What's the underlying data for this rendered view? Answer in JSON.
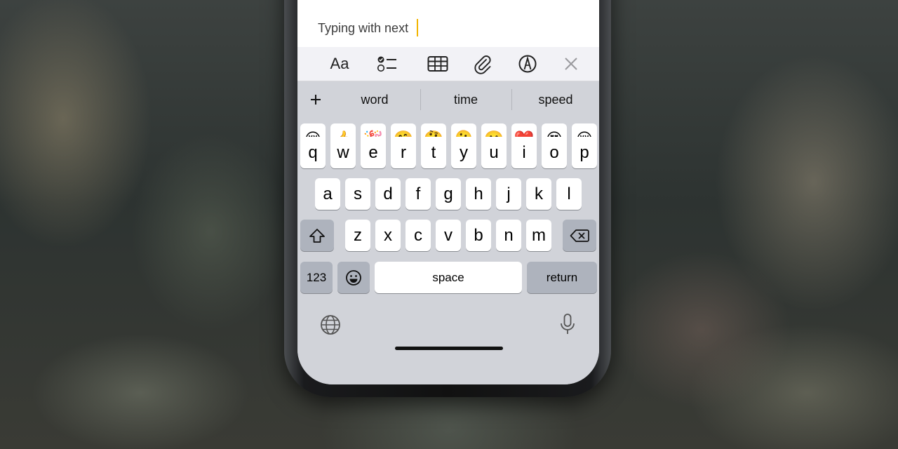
{
  "note": {
    "typed_text": "Typing with next"
  },
  "format_bar": {
    "text_style_label": "Aa",
    "icons": [
      "text-style-icon",
      "checklist-icon",
      "table-icon",
      "paperclip-icon",
      "markup-pen-icon",
      "close-icon"
    ]
  },
  "predictions": {
    "items": [
      "word",
      "time",
      "speed"
    ],
    "add_icon": "plus-icon"
  },
  "emoji_suggestions": [
    "😢",
    "👍",
    "🎉",
    "🤗",
    "🤔",
    "🫠",
    "🤫",
    "❤️",
    "😍",
    "😔"
  ],
  "keyboard": {
    "row1": [
      "q",
      "w",
      "e",
      "r",
      "t",
      "y",
      "u",
      "i",
      "o",
      "p"
    ],
    "row2": [
      "a",
      "s",
      "d",
      "f",
      "g",
      "h",
      "j",
      "k",
      "l"
    ],
    "row3": [
      "z",
      "x",
      "c",
      "v",
      "b",
      "n",
      "m"
    ],
    "numbers_label": "123",
    "space_label": "space",
    "return_label": "return"
  },
  "colors": {
    "caret": "#f2b400",
    "keyboard_bg": "#d1d3d9",
    "dark_key": "#aeb3bd"
  }
}
